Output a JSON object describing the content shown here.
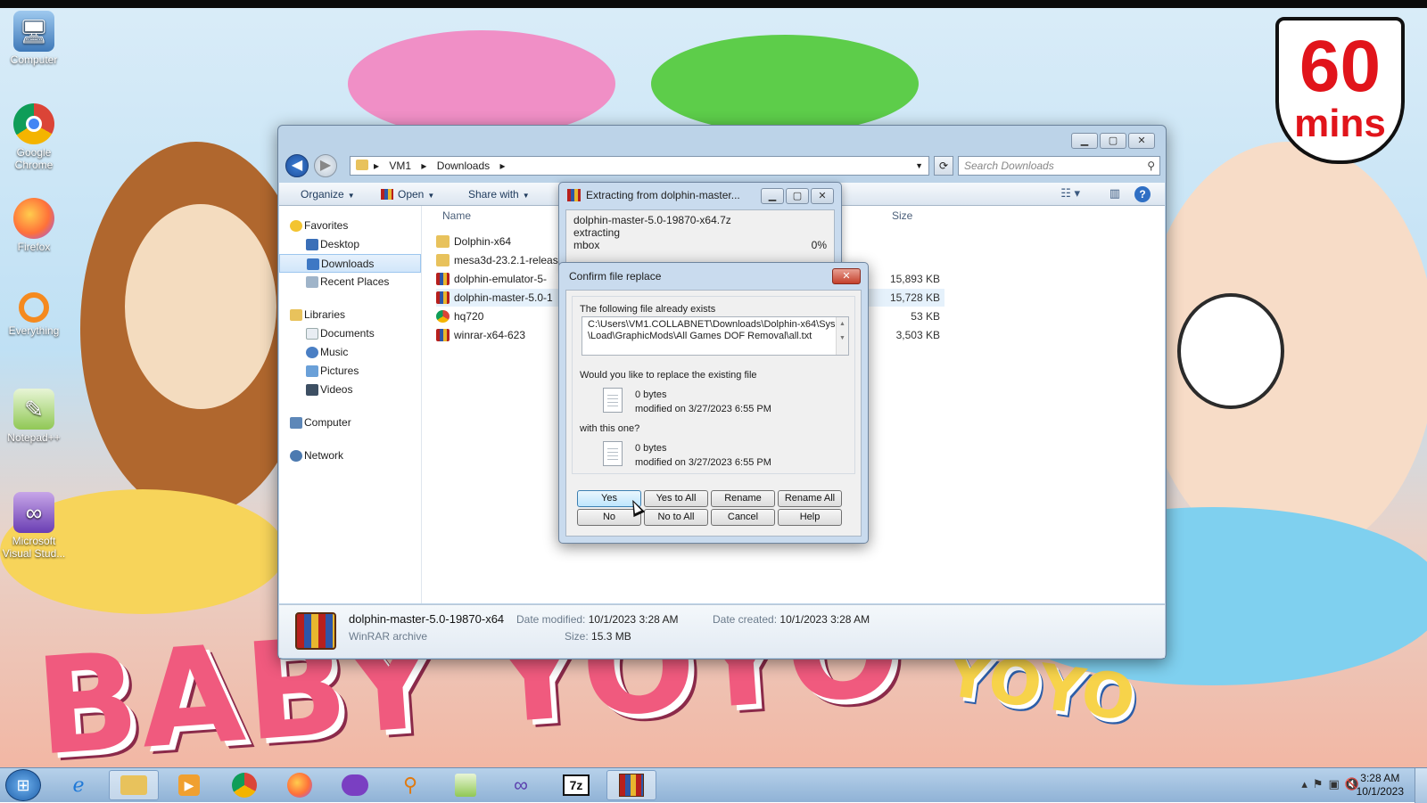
{
  "wallpaper": {
    "brand": "BABY YOYO",
    "brand2": "YOYO",
    "badge_number": "60",
    "badge_unit": "mins"
  },
  "desktop_icons": [
    {
      "label": "Computer",
      "icon": "computer-icon"
    },
    {
      "label": "Google Chrome",
      "icon": "chrome-icon"
    },
    {
      "label": "Firefox",
      "icon": "firefox-icon"
    },
    {
      "label": "Everything",
      "icon": "everything-search-icon"
    },
    {
      "label": "Notepad++",
      "icon": "notepadpp-icon"
    },
    {
      "label": "Microsoft Visual Stud...",
      "icon": "visual-studio-icon"
    }
  ],
  "explorer": {
    "breadcrumb": [
      "VM1",
      "Downloads"
    ],
    "search_placeholder": "Search Downloads",
    "toolbar": {
      "organize": "Organize",
      "open": "Open",
      "share_with": "Share with"
    },
    "nav": {
      "favorites": "Favorites",
      "favorites_items": [
        "Desktop",
        "Downloads",
        "Recent Places"
      ],
      "libraries": "Libraries",
      "libraries_items": [
        "Documents",
        "Music",
        "Pictures",
        "Videos"
      ],
      "computer": "Computer",
      "network": "Network"
    },
    "columns": {
      "name": "Name",
      "size": "Size"
    },
    "files": [
      {
        "name": "Dolphin-x64",
        "size": "",
        "type": "folder"
      },
      {
        "name": "mesa3d-23.2.1-releas",
        "size": "",
        "type": "folder"
      },
      {
        "name": "dolphin-emulator-5-",
        "size": "15,893 KB",
        "type": "winrar"
      },
      {
        "name": "dolphin-master-5.0-1",
        "size": "15,728 KB",
        "type": "winrar"
      },
      {
        "name": "hq720",
        "size": "53 KB",
        "type": "chrome"
      },
      {
        "name": "winrar-x64-623",
        "size": "3,503 KB",
        "type": "winrar"
      }
    ],
    "details": {
      "name": "dolphin-master-5.0-19870-x64",
      "type": "WinRAR archive",
      "date_modified_label": "Date modified:",
      "date_modified": "10/1/2023 3:28 AM",
      "date_created_label": "Date created:",
      "date_created": "10/1/2023 3:28 AM",
      "size_label": "Size:",
      "size": "15.3 MB"
    }
  },
  "extracting": {
    "title": "Extracting from dolphin-master...",
    "archive": "dolphin-master-5.0-19870-x64.7z",
    "status": "extracting",
    "current_file": "mbox",
    "percent": "0%"
  },
  "confirm": {
    "title": "Confirm file replace",
    "exists_text": "The following file already exists",
    "path_line1": "C:\\Users\\VM1.COLLABNET\\Downloads\\Dolphin-x64\\Sys",
    "path_line2": "\\Load\\GraphicMods\\All Games DOF Removal\\all.txt",
    "question": "Would you like to replace the existing file",
    "existing_size": "0 bytes",
    "existing_modified": "modified on 3/27/2023 6:55 PM",
    "with_text": "with this one?",
    "new_size": "0 bytes",
    "new_modified": "modified on 3/27/2023 6:55 PM",
    "buttons": {
      "yes": "Yes",
      "yes_all": "Yes to All",
      "rename": "Rename",
      "rename_all": "Rename All",
      "no": "No",
      "no_all": "No to All",
      "cancel": "Cancel",
      "help": "Help"
    }
  },
  "taskbar": {
    "apps": [
      "internet-explorer-icon",
      "file-explorer-icon",
      "media-player-icon",
      "chrome-icon",
      "firefox-icon",
      "mask-app-icon",
      "search-tool-icon",
      "notepadpp-icon",
      "visual-studio-icon",
      "7zip-icon",
      "winrar-icon"
    ],
    "time": "3:28 AM",
    "date": "10/1/2023"
  },
  "colors": {
    "accent": "#1e4f9b",
    "winframe": "#bcd3e8",
    "close_red": "#c4402b"
  }
}
